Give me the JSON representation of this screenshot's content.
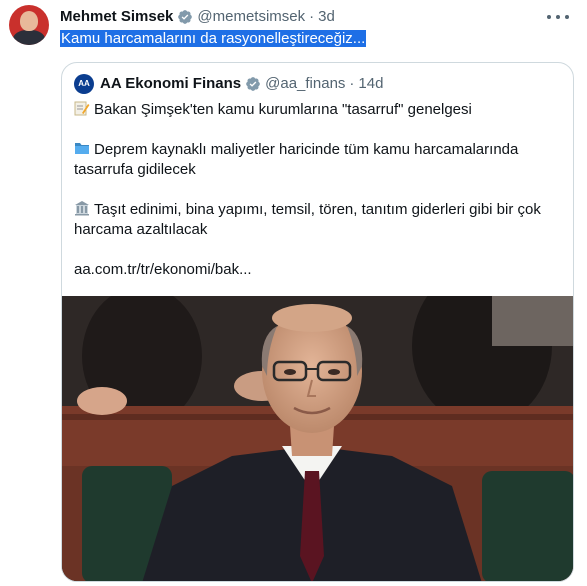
{
  "tweet": {
    "author_name": "Mehmet Simsek",
    "author_handle": "@memetsimsek",
    "separator": "·",
    "time": "3d",
    "text": "Kamu harcamalarını da rasyonelleştireceğiz..."
  },
  "quoted": {
    "logo_text": "AA",
    "author_name": "AA Ekonomi Finans",
    "author_handle": "@aa_finans",
    "separator": "·",
    "time": "14d",
    "line1": "Bakan Şimşek'ten kamu kurumlarına \"tasarruf\" genelgesi",
    "line2a": "Deprem kaynaklı maliyetler haricinde tüm kamu harcamalarında",
    "line2b": "tasarrufa gidilecek",
    "line3a": "Taşıt edinimi, bina yapımı, temsil, tören, tanıtım giderleri gibi bir çok",
    "line3b": "harcama azaltılacak",
    "link": "aa.com.tr/tr/ekonomi/bak..."
  },
  "icons": {
    "verified": "verified-badge-icon",
    "more": "more-options-icon",
    "memo": "memo-pencil-icon",
    "folder": "folder-icon",
    "building": "building-icon"
  },
  "colors": {
    "accent": "#1d9bf0",
    "selection": "#1e6fe6",
    "text": "#0f1419",
    "secondary": "#536471",
    "border": "#cfd9de"
  }
}
